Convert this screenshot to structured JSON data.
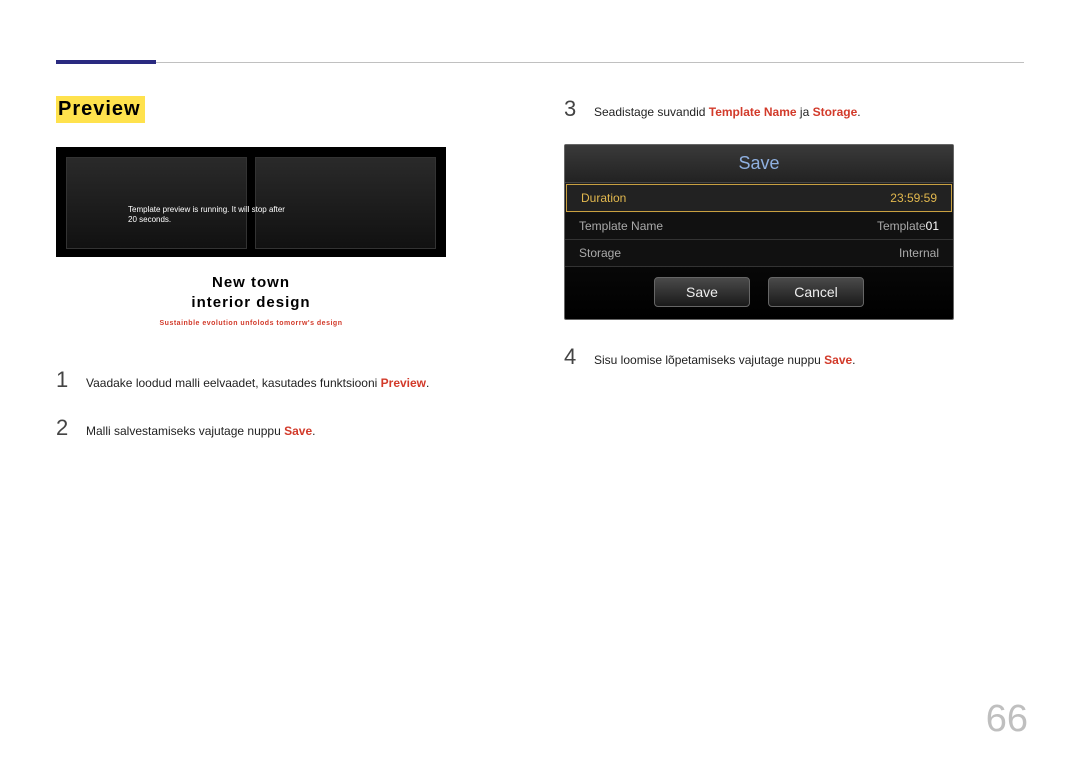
{
  "page_number": "66",
  "left": {
    "section_title": "Preview",
    "preview": {
      "overlay_line1": "Template preview is running. It will stop after",
      "overlay_line2": "20 seconds.",
      "heading_line1": "New town",
      "heading_line2": "interior design",
      "subline": "Sustainble evolution unfolods tomorrw's design"
    },
    "step1": {
      "num": "1",
      "text_a": "Vaadake loodud malli eelvaadet, kasutades funktsiooni ",
      "hl": "Preview",
      "text_b": "."
    },
    "step2": {
      "num": "2",
      "text_a": "Malli salvestamiseks vajutage nuppu ",
      "hl": "Save",
      "text_b": "."
    }
  },
  "right": {
    "step3": {
      "num": "3",
      "text_a": "Seadistage suvandid ",
      "hl1": "Template Name",
      "mid": " ja ",
      "hl2": "Storage",
      "text_b": "."
    },
    "dialog": {
      "title": "Save",
      "rows": {
        "duration_label": "Duration",
        "duration_value": "23:59:59",
        "template_label": "Template Name",
        "template_value_prefix": "Template",
        "template_value_suffix": "01",
        "storage_label": "Storage",
        "storage_value": "Internal"
      },
      "btn_save": "Save",
      "btn_cancel": "Cancel"
    },
    "step4": {
      "num": "4",
      "text_a": "Sisu loomise lõpetamiseks vajutage nuppu ",
      "hl": "Save",
      "text_b": "."
    }
  }
}
